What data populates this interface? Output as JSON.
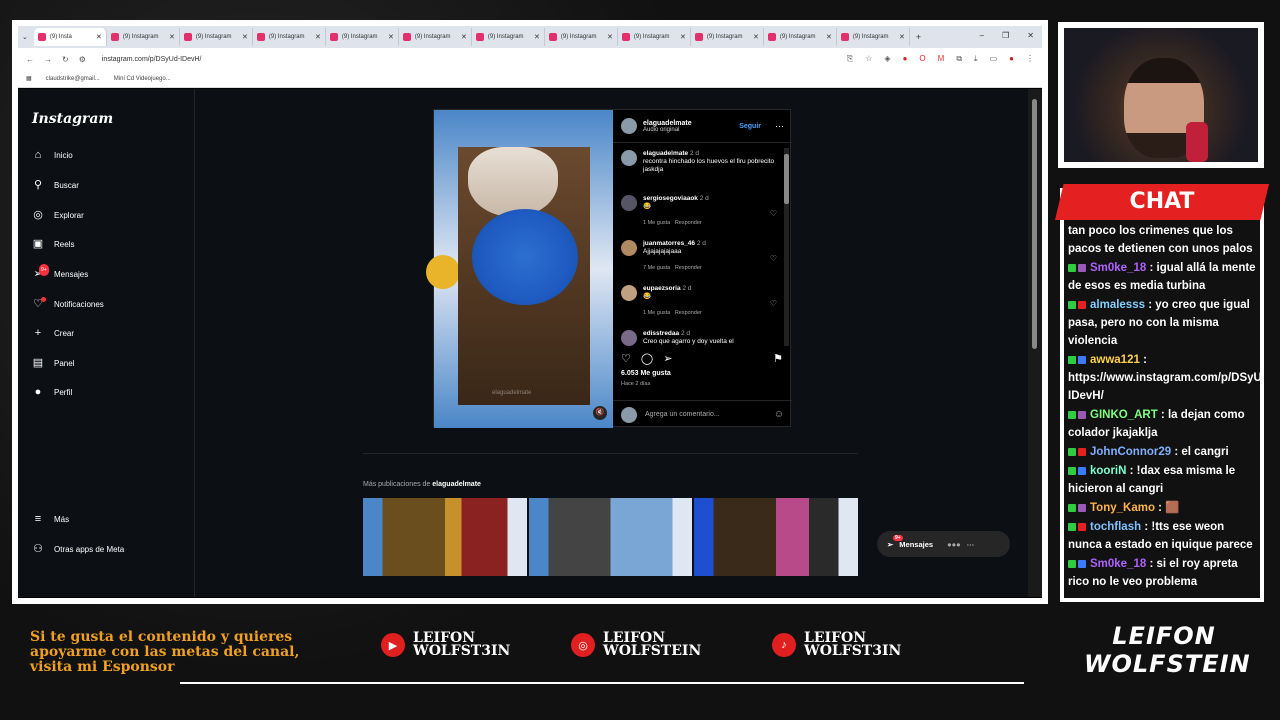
{
  "browser": {
    "tabs": [
      {
        "label": "(9) Insta",
        "active": true
      },
      {
        "label": "(9) Instagram"
      },
      {
        "label": "(9) Instagram"
      },
      {
        "label": "(9) Instagram"
      },
      {
        "label": "(9) Instagram"
      },
      {
        "label": "(9) Instagram"
      },
      {
        "label": "(9) Instagram"
      },
      {
        "label": "(9) Instagram"
      },
      {
        "label": "(9) Instagram"
      },
      {
        "label": "(9) Instagram"
      },
      {
        "label": "(9) Instagram"
      },
      {
        "label": "(9) Instagram"
      }
    ],
    "url": "instagram.com/p/DSyUd-IDevH/",
    "bookmarks": [
      "claudstrike@gmail...",
      "Mini Cd Videojuego..."
    ]
  },
  "instagram": {
    "logo": "Instagram",
    "nav": [
      {
        "label": "Inicio",
        "icon": "home-icon"
      },
      {
        "label": "Buscar",
        "icon": "search-icon"
      },
      {
        "label": "Explorar",
        "icon": "compass-icon"
      },
      {
        "label": "Reels",
        "icon": "reels-icon"
      },
      {
        "label": "Mensajes",
        "icon": "messages-icon",
        "badge": "9+"
      },
      {
        "label": "Notificaciones",
        "icon": "heart-icon"
      },
      {
        "label": "Crear",
        "icon": "plus-icon"
      },
      {
        "label": "Panel",
        "icon": "panel-icon"
      },
      {
        "label": "Perfil",
        "icon": "profile-icon"
      },
      {
        "label": "Más",
        "icon": "menu-icon"
      },
      {
        "label": "Otras apps de Meta",
        "icon": "meta-icon"
      }
    ],
    "post": {
      "user": "elaguadelmate",
      "audio": "Audio original",
      "follow": "Seguir",
      "watermark": "elaguadelmate",
      "caption": {
        "user": "elaguadelmate",
        "time": "2 d",
        "text": "recontra hinchado los huevos el firu pobrecito jaskdja"
      },
      "comments": [
        {
          "user": "sergiosegoviaaok",
          "time": "2 d",
          "text": "😂",
          "likes": "1 Me gusta",
          "reply": "Responder"
        },
        {
          "user": "juanmatorres_46",
          "time": "2 d",
          "text": "Ajjajajajajaaa",
          "likes": "7 Me gusta",
          "reply": "Responder"
        },
        {
          "user": "eupaezsoria",
          "time": "2 d",
          "text": "😂",
          "likes": "1 Me gusta",
          "reply": "Responder"
        },
        {
          "user": "edisstredaa",
          "time": "2 d",
          "text": "Creo que agarro y doy vuelta el",
          "likes": "",
          "reply": ""
        }
      ],
      "likes": "6.053 Me gusta",
      "ago": "Hace 2 días",
      "add_comment": "Agrega un comentario..."
    },
    "more_label": "Más publicaciones de",
    "more_user": "elaguadelmate",
    "messages_pill": "Mensajes",
    "messages_badge": "9+"
  },
  "chat": {
    "title": "CHAT",
    "messages": [
      {
        "user": "",
        "color": "#ffffff",
        "text": "tan poco los crimenes que los pacos te detienen con unos palos"
      },
      {
        "user": "Sm0ke_18",
        "color": "#b060ff",
        "text": "igual allá la mente de esos es media turbina"
      },
      {
        "user": "almalesss",
        "color": "#7fd0ff",
        "text": "yo creo que igual pasa, pero no con la misma violencia"
      },
      {
        "user": "awwa121",
        "color": "#ffd24a",
        "text": "https://www.instagram.com/p/DSyUd-IDevH/"
      },
      {
        "user": "GINKO_ART",
        "color": "#7fff7f",
        "text": "la dejan como colador jkajaklja"
      },
      {
        "user": "JohnConnor29",
        "color": "#7fb0ff",
        "text": "el cangri"
      },
      {
        "user": "kooriN",
        "color": "#7fffcf",
        "text": "!dax esa misma le hicieron al cangri"
      },
      {
        "user": "Tony_Kamo",
        "color": "#ffb347",
        "text": "🟫"
      },
      {
        "user": "tochflash",
        "color": "#7fc0ff",
        "text": "!tts ese weon nunca a estado en iquique parece"
      },
      {
        "user": "Sm0ke_18",
        "color": "#b060ff",
        "text": "si el roy apreta rico no le veo problema"
      }
    ]
  },
  "overlay": {
    "support_text": "Si te gusta el contenido y quieres apoyarme con las metas del canal, visita mi Esponsor",
    "socials": [
      {
        "icon": "youtube-icon",
        "line1": "LEIFON",
        "line2": "WOLFST3IN"
      },
      {
        "icon": "instagram-icon",
        "line1": "LEIFON",
        "line2": "WOLFSTEIN"
      },
      {
        "icon": "tiktok-icon",
        "line1": "LEIFON",
        "line2": "WOLFST3IN"
      }
    ],
    "brand_line1": "LEIFON",
    "brand_line2": "WOLFSTEIN"
  },
  "colors": {
    "chat_header": "#e52020",
    "accent": "#f0a020",
    "ig_link": "#4aa3ff"
  }
}
